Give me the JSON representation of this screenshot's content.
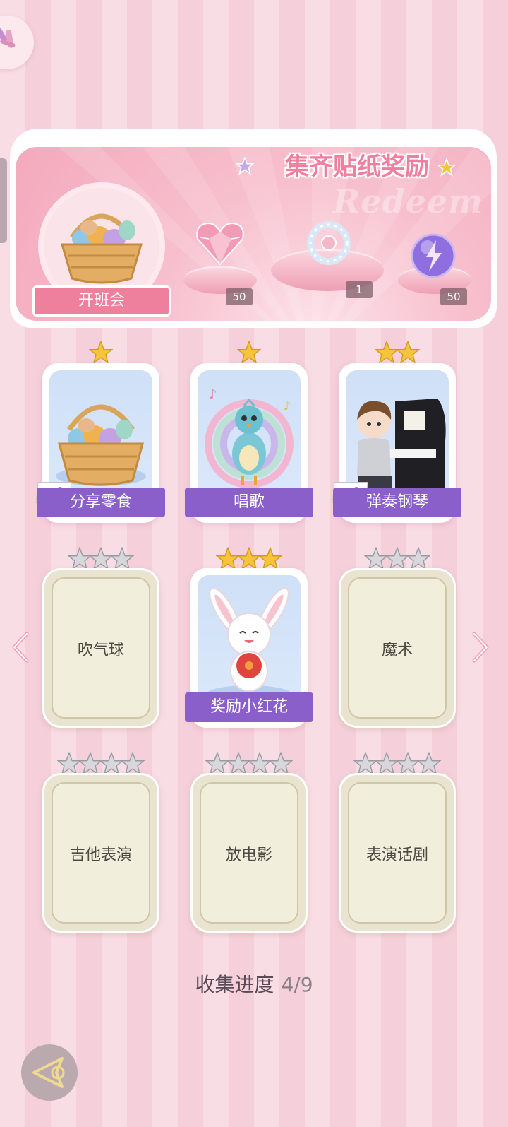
{
  "panel": {
    "banner_title": "集齐贴纸奖励",
    "watermark": "Redeem",
    "title": "开班会",
    "rewards": [
      {
        "icon": "pink-heart-gem-icon",
        "count": "50"
      },
      {
        "icon": "crystal-bracelet-icon",
        "count": "1"
      },
      {
        "icon": "purple-lightning-orb-icon",
        "count": "50"
      }
    ]
  },
  "cards": [
    {
      "label": "分享零食",
      "stars": 1,
      "bonus": "+6",
      "unlocked": true,
      "icon": "snack-basket-icon"
    },
    {
      "label": "唱歌",
      "stars": 1,
      "unlocked": true,
      "icon": "singing-peacock-icon"
    },
    {
      "label": "弹奏钢琴",
      "stars": 2,
      "bonus": "+6",
      "unlocked": true,
      "icon": "piano-boy-icon"
    },
    {
      "label": "吹气球",
      "stars": 3,
      "unlocked": false
    },
    {
      "label": "奖励小红花",
      "stars": 3,
      "unlocked": true,
      "icon": "bunny-red-flower-icon"
    },
    {
      "label": "魔术",
      "stars": 3,
      "unlocked": false
    },
    {
      "label": "吉他表演",
      "stars": 4,
      "unlocked": false
    },
    {
      "label": "放电影",
      "stars": 4,
      "unlocked": false
    },
    {
      "label": "表演话剧",
      "stars": 4,
      "unlocked": false
    }
  ],
  "progress": {
    "label": "收集进度",
    "value": "4/9"
  },
  "colors": {
    "accent": "#ee7f9d",
    "label_purple": "#8a5fc9",
    "gold_star": "#f5c43a",
    "gray_star": "#cfcfd4"
  }
}
